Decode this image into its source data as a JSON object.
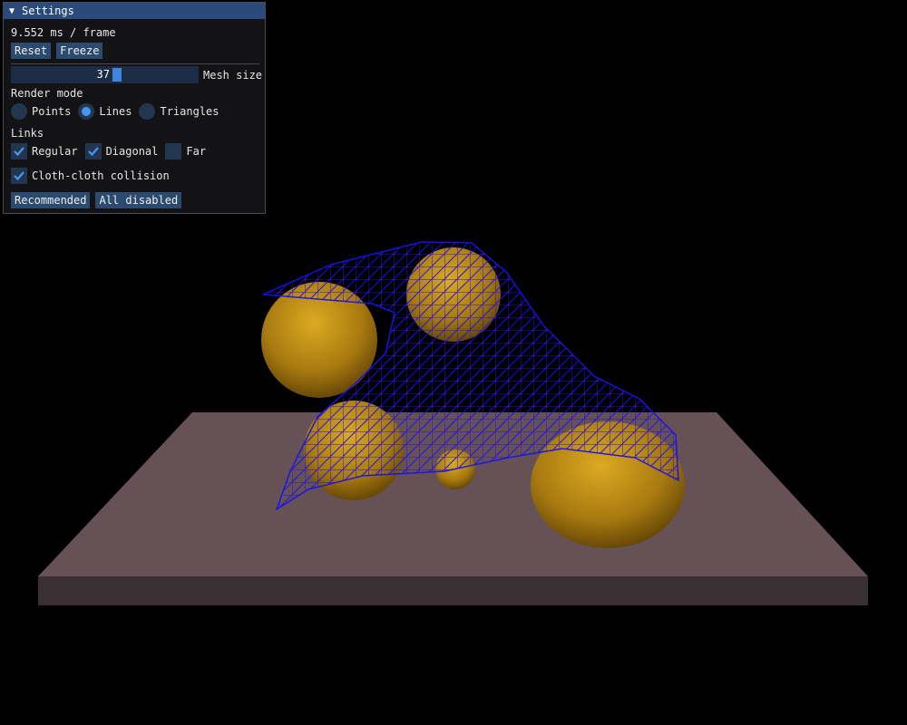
{
  "window": {
    "title": "Settings",
    "frame_time": "9.552 ms / frame",
    "buttons": {
      "reset": "Reset",
      "freeze": "Freeze",
      "recommended": "Recommended",
      "all_disabled": "All disabled"
    },
    "mesh_size": {
      "label": "Mesh size",
      "value": "37"
    },
    "render_mode": {
      "label": "Render mode",
      "options": [
        "Points",
        "Lines",
        "Triangles"
      ],
      "selected": "Lines"
    },
    "links": {
      "label": "Links",
      "regular": {
        "label": "Regular",
        "checked": true
      },
      "diagonal": {
        "label": "Diagonal",
        "checked": true
      },
      "far": {
        "label": "Far",
        "checked": false
      }
    },
    "cloth_collision": {
      "label": "Cloth-cloth collision",
      "checked": true
    }
  },
  "colors": {
    "background": "#000000",
    "table_top": "#665256",
    "table_side": "#3a2f32",
    "sphere_light": "#d8a51c",
    "sphere_dark": "#6e4d06",
    "cloth_lines": "#1b12e8",
    "cloth_vertices": "#e0003c"
  }
}
